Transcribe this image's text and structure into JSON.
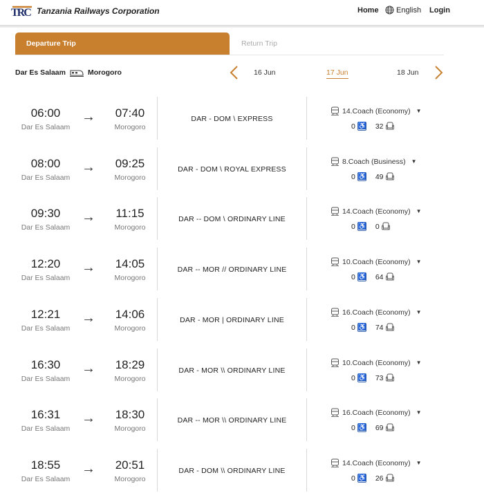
{
  "header": {
    "brand": "Tanzania Railways Corporation",
    "logo_text": "TRC",
    "nav": {
      "home": "Home",
      "language": "English",
      "login": "Login"
    }
  },
  "tabs": {
    "departure": "Departure Trip",
    "return": "Return Trip"
  },
  "route": {
    "from": "Dar Es Salaam",
    "to": "Morogoro"
  },
  "dates": {
    "prev": "16 Jun",
    "current": "17 Jun",
    "next": "18 Jun"
  },
  "colors": {
    "accent": "#c87f2e",
    "wheelchair": "#3a66b0"
  },
  "trips": [
    {
      "dep_time": "06:00",
      "dep_city": "Dar Es Salaam",
      "arr_time": "07:40",
      "arr_city": "Morogoro",
      "line": "DAR - DOM \\ EXPRESS",
      "coach": "14.Coach (Economy)",
      "wheelchair": "0",
      "seats": "32"
    },
    {
      "dep_time": "08:00",
      "dep_city": "Dar Es Salaam",
      "arr_time": "09:25",
      "arr_city": "Morogoro",
      "line": "DAR - DOM \\ ROYAL EXPRESS",
      "coach": "8.Coach (Business)",
      "wheelchair": "0",
      "seats": "49"
    },
    {
      "dep_time": "09:30",
      "dep_city": "Dar Es Salaam",
      "arr_time": "11:15",
      "arr_city": "Morogoro",
      "line": "DAR -- DOM \\ ORDINARY LINE",
      "coach": "14.Coach (Economy)",
      "wheelchair": "0",
      "seats": "0"
    },
    {
      "dep_time": "12:20",
      "dep_city": "Dar Es Salaam",
      "arr_time": "14:05",
      "arr_city": "Morogoro",
      "line": "DAR -- MOR // ORDINARY LINE",
      "coach": "10.Coach (Economy)",
      "wheelchair": "0",
      "seats": "64"
    },
    {
      "dep_time": "12:21",
      "dep_city": "Dar Es Salaam",
      "arr_time": "14:06",
      "arr_city": "Morogoro",
      "line": "DAR - MOR | ORDINARY LINE",
      "coach": "16.Coach (Economy)",
      "wheelchair": "0",
      "seats": "74"
    },
    {
      "dep_time": "16:30",
      "dep_city": "Dar Es Salaam",
      "arr_time": "18:29",
      "arr_city": "Morogoro",
      "line": "DAR - MOR \\\\ ORDINARY LINE",
      "coach": "10.Coach (Economy)",
      "wheelchair": "0",
      "seats": "73"
    },
    {
      "dep_time": "16:31",
      "dep_city": "Dar Es Salaam",
      "arr_time": "18:30",
      "arr_city": "Morogoro",
      "line": "DAR -- MOR \\\\ ORDINARY LINE",
      "coach": "16.Coach (Economy)",
      "wheelchair": "0",
      "seats": "69"
    },
    {
      "dep_time": "18:55",
      "dep_city": "Dar Es Salaam",
      "arr_time": "20:51",
      "arr_city": "Morogoro",
      "line": "DAR - DOM \\\\ ORDINARY LINE",
      "coach": "14.Coach (Economy)",
      "wheelchair": "0",
      "seats": "26"
    }
  ]
}
